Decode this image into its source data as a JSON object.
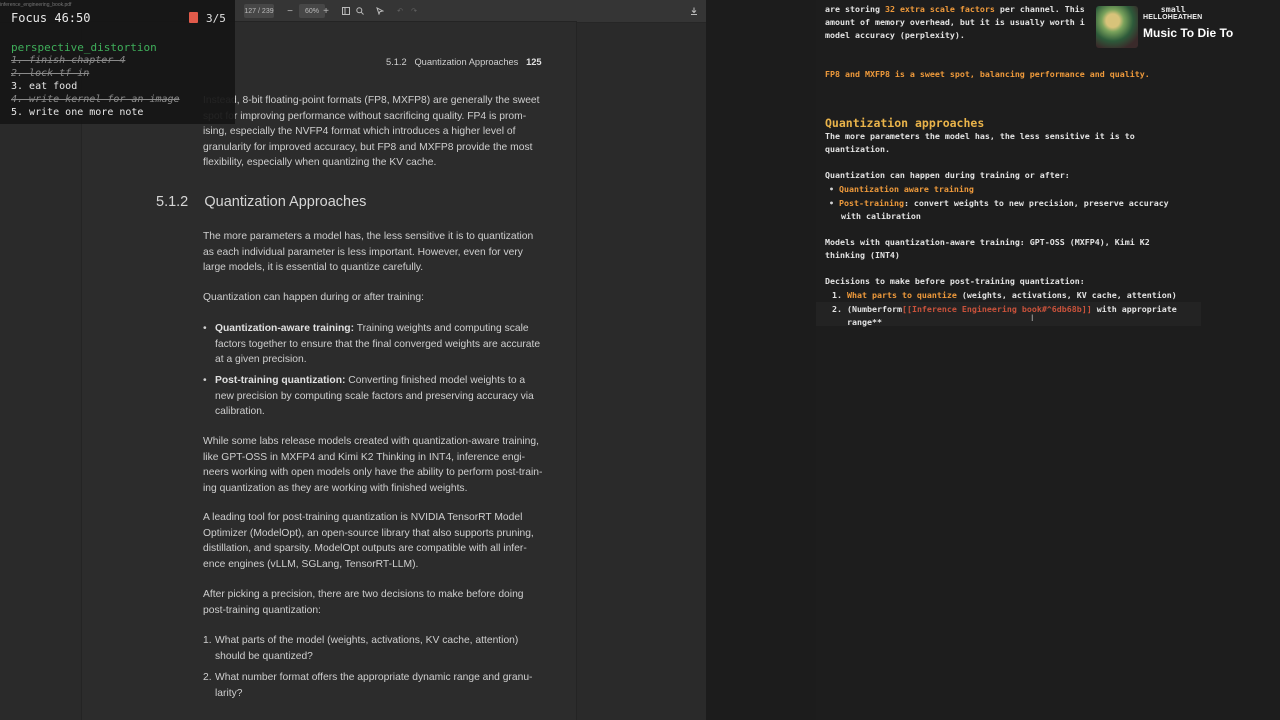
{
  "pdf": {
    "toolbar": {
      "page_current": "127",
      "page_total": "239",
      "zoom": "60%",
      "zoom_out": "−",
      "zoom_in": "+"
    },
    "running_header": {
      "section": "5.1.2",
      "title": "Quantization Approaches",
      "page": "125"
    },
    "intro_lines": [
      "Instead, 8-bit floating-point formats (FP8, MXFP8) are generally the sweet",
      "spot for improving performance without sacrificing quality. FP4 is prom-",
      "ising, especially the NVFP4 format which introduces a higher level of",
      "granularity for improved accuracy, but FP8 and MXFP8 provide the most",
      "flexibility, especially when quantizing the KV cache."
    ],
    "section": {
      "number": "5.1.2",
      "title": "Quantization Approaches"
    },
    "para1": [
      "The more parameters a model has, the less sensitive it is to quantization",
      "as each individual parameter is less important. However, even for very",
      "large models, it is essential to quantize carefully."
    ],
    "para2": "Quantization can happen during or after training:",
    "bullet1": {
      "term": "Quantization-aware training:",
      "first": "Training weights and computing scale",
      "rest": [
        "factors together to ensure that the final converged weights are accurate",
        "at a given precision."
      ]
    },
    "bullet2": {
      "term": "Post-training quantization:",
      "first": "Converting finished model weights to a",
      "rest": [
        "new precision by computing scale factors and preserving accuracy via",
        "calibration."
      ]
    },
    "para3": [
      "While some labs release models created with quantization-aware training,",
      "like GPT-OSS in MXFP4 and Kimi K2 Thinking in INT4, inference engi-",
      "neers working with open models only have the ability to perform post-train-",
      "ing quantization as they are working with finished weights."
    ],
    "para4": [
      "A leading tool for post-training quantization is NVIDIA TensorRT Model",
      "Optimizer (ModelOpt), an open-source library that also supports pruning,",
      "distillation, and sparsity. ModelOpt outputs are compatible with all infer-",
      "ence engines (vLLM, SGLang, TensorRT-LLM)."
    ],
    "para5": [
      "After picking a precision, there are two decisions to make before doing",
      "post-training quantization:"
    ],
    "list": [
      {
        "num": "1.",
        "lines": [
          "What parts of the model (weights, activations, KV cache, attention)",
          "should be quantized?"
        ]
      },
      {
        "num": "2.",
        "lines": [
          "What number format offers the appropriate dynamic range and granu-",
          "larity?"
        ]
      }
    ]
  },
  "focus": {
    "file_label": "inference_engineering_book.pdf",
    "title": "Focus 46:50",
    "count": "3/5",
    "list_name": "perspective_distortion",
    "items": [
      {
        "text": "1. finish chapter 4",
        "done": true
      },
      {
        "text": "2. lock tf in",
        "done": true
      },
      {
        "text": "3. eat food",
        "done": false
      },
      {
        "text": "4. write kernel for an image",
        "done": true
      },
      {
        "text": "5. write one more note",
        "done": false
      }
    ]
  },
  "notes": {
    "top": {
      "l1a": "are storing ",
      "l1b": "32 extra scale factors",
      "l1c": " per channel. This",
      "l1d": "small",
      "l2a": "amount of memory overhead, but it is usually worth i",
      "l3": "model accuracy (perplexity)."
    },
    "sweet_spot": "FP8 and MXFP8 is a sweet spot, balancing performance and quality.",
    "heading": "Quantization approaches",
    "p1": [
      "The more parameters the model has, the less sensitive it is to",
      "quantization."
    ],
    "p2": "Quantization can happen during training or after:",
    "b1": "Quantization aware training",
    "b2_term": "Post-training",
    "b2_rest": ": convert weights to new precision, preserve accuracy",
    "b2_cont": "with calibration",
    "p3": [
      "Models with quantization-aware training: GPT-OSS (MXFP4), Kimi K2",
      "thinking (INT4)"
    ],
    "p4": "Decisions to make before post-training quantization:",
    "d1_num": "1.",
    "d1_term": "What parts to quantize",
    "d1_rest": " (weights, activations, KV cache, attention)",
    "d2_num": "2.",
    "d2_a": "(Numberform",
    "d2_link": "[[Inference Engineering book#^6db68b]]",
    "d2_b": " with appropriate",
    "d2_c": "range**"
  },
  "music": {
    "artist": "HELLOHEATHEN",
    "song": "Music To Die To"
  },
  "colors": {
    "orange": "#ef9a3b",
    "heading": "#e9b34a",
    "green": "#3fae5a",
    "link": "#c9523b",
    "pdf_icon": "#e05a4a"
  },
  "icons": [
    "pdf-icon",
    "sidebar-icon",
    "search-icon",
    "download-icon",
    "undo-icon",
    "redo-icon"
  ]
}
